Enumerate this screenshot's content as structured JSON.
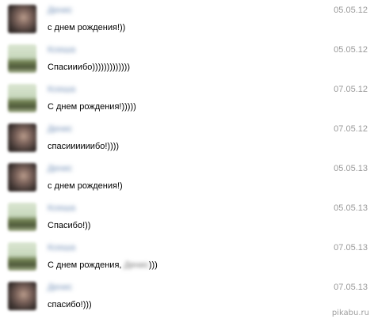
{
  "messages": [
    {
      "author": "Денис",
      "avatar": "dark",
      "date": "05.05.12",
      "text": "с днем рождения!))",
      "blurred_suffix": "",
      "text_after": ""
    },
    {
      "author": "Ксюша",
      "avatar": "green",
      "date": "05.05.12",
      "text": "Спасииибо)))))))))))))",
      "blurred_suffix": "",
      "text_after": ""
    },
    {
      "author": "Ксюша",
      "avatar": "green",
      "date": "07.05.12",
      "text": "С днем рождения!)))))",
      "blurred_suffix": "",
      "text_after": ""
    },
    {
      "author": "Денис",
      "avatar": "dark",
      "date": "07.05.12",
      "text": "спасиииииибо!))))",
      "blurred_suffix": "",
      "text_after": ""
    },
    {
      "author": "Денис",
      "avatar": "dark",
      "date": "05.05.13",
      "text": "с днем рождения!)",
      "blurred_suffix": "",
      "text_after": ""
    },
    {
      "author": "Ксюша",
      "avatar": "green",
      "date": "05.05.13",
      "text": "Спасибо!))",
      "blurred_suffix": "",
      "text_after": ""
    },
    {
      "author": "Ксюша",
      "avatar": "green",
      "date": "07.05.13",
      "text": "С днем рождения, ",
      "blurred_suffix": "Денис",
      "text_after": ")))"
    },
    {
      "author": "Денис",
      "avatar": "dark",
      "date": "07.05.13",
      "text": "спасибо!)))",
      "blurred_suffix": "",
      "text_after": ""
    }
  ],
  "watermark": "pikabu.ru",
  "colors": {
    "author": "#6f8db5",
    "date": "#9a9a9a",
    "text": "#000000"
  }
}
